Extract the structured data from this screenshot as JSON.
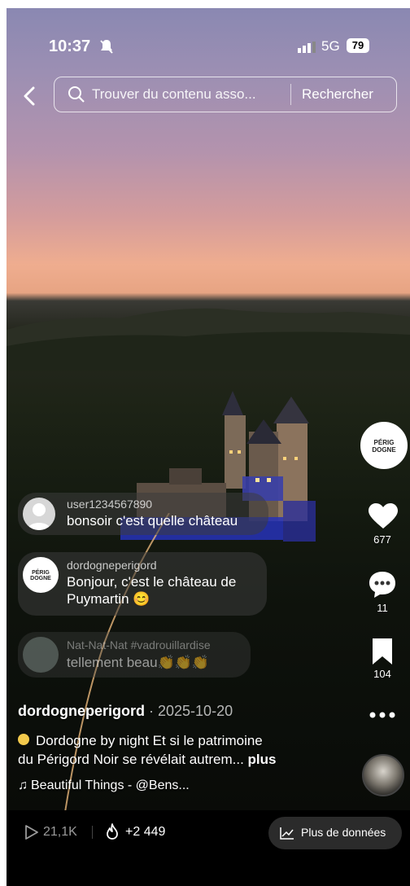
{
  "status_bar": {
    "time": "10:37",
    "network": "5G",
    "battery": "79"
  },
  "search": {
    "placeholder": "Trouver du contenu asso...",
    "button_label": "Rechercher"
  },
  "side_actions": {
    "creator_avatar_text": "PÉRIG DOGNE",
    "likes": "677",
    "comments": "11",
    "saves": "104"
  },
  "comments": [
    {
      "user": "user1234567890",
      "text": "bonsoir c'est quelle château"
    },
    {
      "user": "dordogneperigord",
      "text_line1": "Bonjour, c'est le château de",
      "text_line2": "Puymartin 😊",
      "avatar_text": "PÉRIG DOGNE"
    },
    {
      "user": "Nat-Nat-Nat #vadrouillardise",
      "text": "tellement beau👏👏👏"
    }
  ],
  "caption": {
    "author": "dordogneperigord",
    "date": "· 2025-10-20",
    "line1": "Dordogne by night Et si le patrimoine",
    "line2": "du Périgord Noir se révélait autrem...",
    "more": "plus",
    "music": "Beautiful Things - @Bens..."
  },
  "bottom_bar": {
    "views": "21,1K",
    "boost": "+2 449",
    "more_data": "Plus de données"
  }
}
